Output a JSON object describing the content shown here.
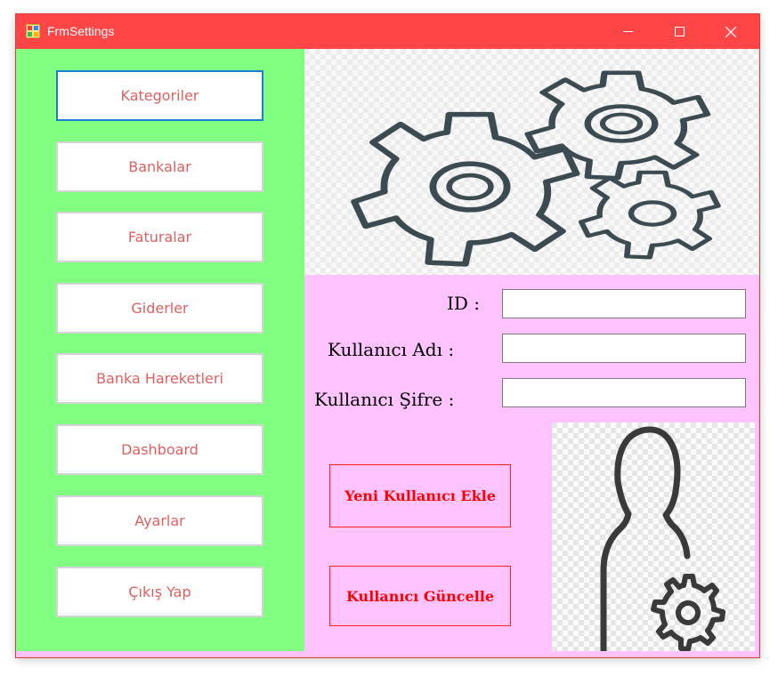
{
  "window": {
    "title": "FrmSettings",
    "titlebar_color": "#ff4545",
    "controls": {
      "minimize_icon": "minimize-icon",
      "maximize_icon": "maximize-icon",
      "close_icon": "close-icon"
    }
  },
  "sidebar": {
    "background": "#80ff80",
    "items": [
      {
        "label": "Kategoriler",
        "active": true
      },
      {
        "label": "Bankalar"
      },
      {
        "label": "Faturalar"
      },
      {
        "label": "Giderler"
      },
      {
        "label": "Banka Hareketleri"
      },
      {
        "label": "Dashboard"
      },
      {
        "label": "Ayarlar"
      },
      {
        "label": "Çıkış Yap"
      }
    ]
  },
  "banner": {
    "icon": "gears-icon"
  },
  "form": {
    "background": "#ffc4ff",
    "id_label": "ID :",
    "username_label": "Kullanıcı Adı :",
    "password_label": "Kullanıcı Şifre :",
    "id_value": "",
    "username_value": "",
    "password_value": ""
  },
  "actions": {
    "new_user_label": "Yeni Kullanıcı Ekle",
    "update_user_label": "Kullanıcı Güncelle",
    "color": "#ff0000"
  },
  "user_image": {
    "icon": "user-settings-icon"
  }
}
